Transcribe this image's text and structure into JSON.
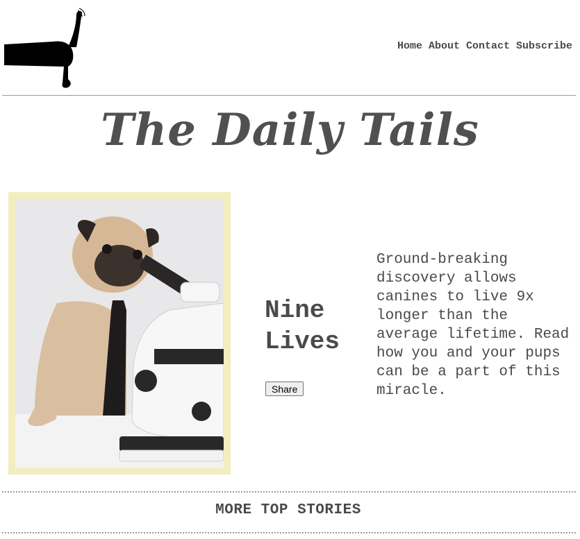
{
  "nav": {
    "items": [
      "Home",
      "About",
      "Contact",
      "Subscribe"
    ]
  },
  "site": {
    "title": "The Daily Tails"
  },
  "story": {
    "title": "Nine Lives",
    "share_label": "Share",
    "blurb": "Ground-breaking discovery allows canines to live 9x longer than the average lifetime. Read how you and your pups can be a part of this miracle."
  },
  "sections": {
    "more_top_stories": "MORE TOP STORIES"
  },
  "colors": {
    "text": "#4a4a4a",
    "photo_frame": "#f2eec0",
    "rule": "#9a9a9a"
  },
  "icons": {
    "logo": "dog-silhouette-logo-icon"
  }
}
